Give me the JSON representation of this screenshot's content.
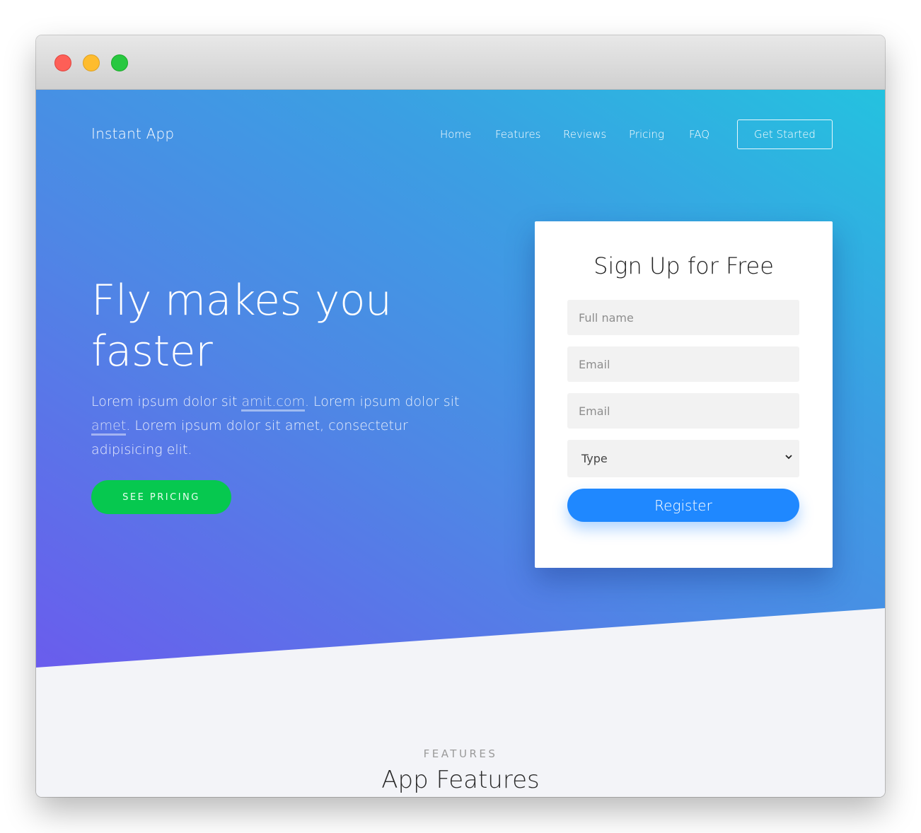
{
  "brand": "Instant App",
  "nav": {
    "items": [
      "Home",
      "Features",
      "Reviews",
      "Pricing",
      "FAQ"
    ],
    "cta_label": "Get Started"
  },
  "hero": {
    "headline": "Fly makes you faster",
    "lead_parts": [
      "Lorem ipsum dolor sit ",
      "amit.com",
      ". Lorem ipsum dolor sit ",
      "amet",
      ". Lorem ipsum dolor sit amet, consectetur adipisicing elit."
    ],
    "button_label": "SEE PRICING"
  },
  "signup": {
    "title": "Sign Up for Free",
    "fields": {
      "full_name_placeholder": "Full name",
      "email_placeholder": "Email",
      "email2_placeholder": "Email",
      "type_selected": "Type"
    },
    "register_label": "Register"
  },
  "features": {
    "eyebrow": "FEATURES",
    "title": "App Features"
  },
  "colors": {
    "green_button": "#06c84f",
    "register_button": "#1f88ff",
    "gradient_start": "#6a5ced",
    "gradient_end": "#24c2df",
    "section_bg": "#f3f4f8"
  },
  "icons": {
    "select_arrow": "chevron-down-icon"
  }
}
